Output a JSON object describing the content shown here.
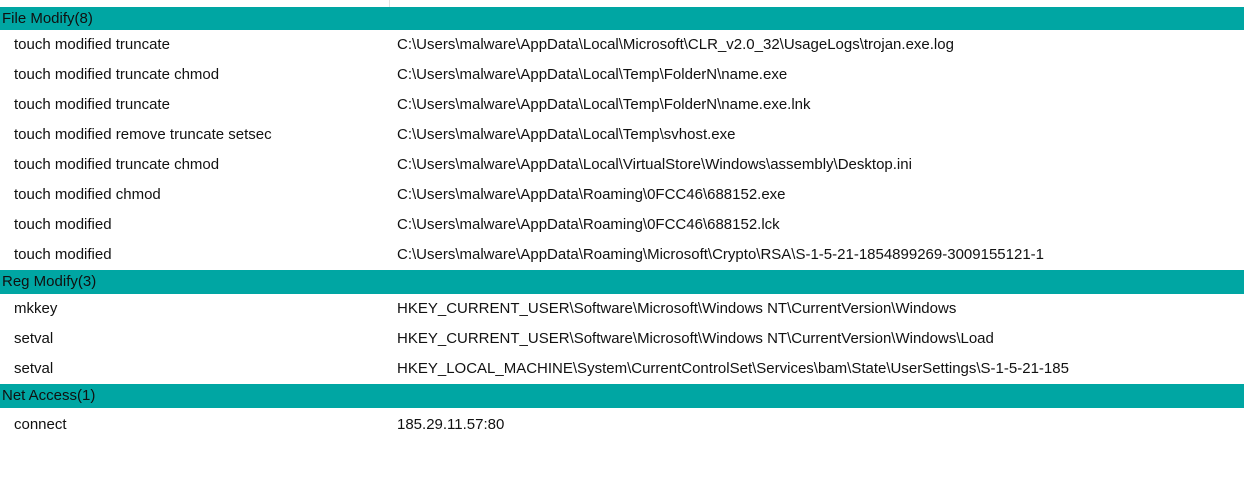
{
  "groups": [
    {
      "header": "File Modify(8)",
      "rows": [
        {
          "op": "touch modified truncate",
          "target": "C:\\Users\\malware\\AppData\\Local\\Microsoft\\CLR_v2.0_32\\UsageLogs\\trojan.exe.log"
        },
        {
          "op": "touch modified truncate chmod",
          "target": "C:\\Users\\malware\\AppData\\Local\\Temp\\FolderN\\name.exe"
        },
        {
          "op": "touch modified truncate",
          "target": "C:\\Users\\malware\\AppData\\Local\\Temp\\FolderN\\name.exe.lnk"
        },
        {
          "op": "touch modified remove truncate setsec",
          "target": "C:\\Users\\malware\\AppData\\Local\\Temp\\svhost.exe"
        },
        {
          "op": "touch modified truncate chmod",
          "target": "C:\\Users\\malware\\AppData\\Local\\VirtualStore\\Windows\\assembly\\Desktop.ini"
        },
        {
          "op": "touch modified chmod",
          "target": "C:\\Users\\malware\\AppData\\Roaming\\0FCC46\\688152.exe"
        },
        {
          "op": "touch modified",
          "target": "C:\\Users\\malware\\AppData\\Roaming\\0FCC46\\688152.lck"
        },
        {
          "op": "touch modified",
          "target": "C:\\Users\\malware\\AppData\\Roaming\\Microsoft\\Crypto\\RSA\\S-1-5-21-1854899269-3009155121-1"
        }
      ]
    },
    {
      "header": "Reg Modify(3)",
      "rows": [
        {
          "op": "mkkey",
          "target": "HKEY_CURRENT_USER\\Software\\Microsoft\\Windows NT\\CurrentVersion\\Windows"
        },
        {
          "op": "setval",
          "target": "HKEY_CURRENT_USER\\Software\\Microsoft\\Windows NT\\CurrentVersion\\Windows\\Load"
        },
        {
          "op": "setval",
          "target": "HKEY_LOCAL_MACHINE\\System\\CurrentControlSet\\Services\\bam\\State\\UserSettings\\S-1-5-21-185"
        }
      ]
    },
    {
      "header": "Net Access(1)",
      "rows": [
        {
          "op": "connect",
          "target": "185.29.11.57:80"
        }
      ]
    }
  ]
}
